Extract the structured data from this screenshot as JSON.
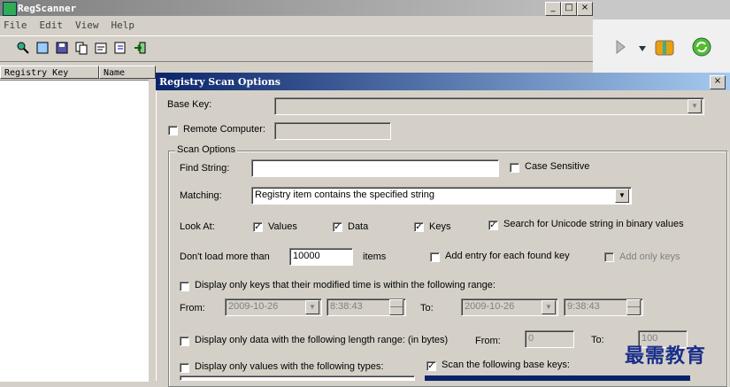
{
  "bg_window": {
    "title": "RegScanner",
    "menu": [
      "File",
      "Edit",
      "View",
      "Help"
    ],
    "columns": [
      "Registry Key",
      "Name"
    ]
  },
  "dialog": {
    "title": "Registry Scan Options",
    "base_key_label": "Base Key:",
    "remote_computer_label": "Remote Computer:",
    "scan_options_label": "Scan Options",
    "find_string_label": "Find String:",
    "find_string_value": "",
    "case_sensitive_label": "Case Sensitive",
    "case_sensitive_checked": false,
    "matching_label": "Matching:",
    "matching_value": "Registry item contains the specified string",
    "look_at_label": "Look At:",
    "values_label": "Values",
    "values_checked": true,
    "data_label": "Data",
    "data_checked": true,
    "keys_label": "Keys",
    "keys_checked": true,
    "unicode_label": "Search for Unicode string in binary values",
    "unicode_checked": true,
    "dont_load_label": "Don't load more than",
    "dont_load_value": "10000",
    "items_label": "items",
    "add_entry_label": "Add entry for each found key",
    "add_only_keys_label": "Add only keys",
    "modified_range_label": "Display only keys that their modified time is within the following range:",
    "from_label": "From:",
    "from_date": "2009-10-26",
    "from_time": "8:38:43",
    "to_label": "To:",
    "to_date": "2009-10-26",
    "to_time": "9:38:43",
    "length_range_label": "Display only data with the following length range: (in bytes)",
    "length_from_label": "From:",
    "length_from_value": "0",
    "length_to_label": "To:",
    "length_to_value": "100",
    "types_label": "Display only values with the following types:",
    "base_keys_label": "Scan the following base keys:",
    "base_keys_checked": true
  },
  "watermark": "最需教育",
  "colors": {
    "title_active": "#0a246a",
    "title_inactive": "#808080",
    "face": "#d4d0c8"
  }
}
